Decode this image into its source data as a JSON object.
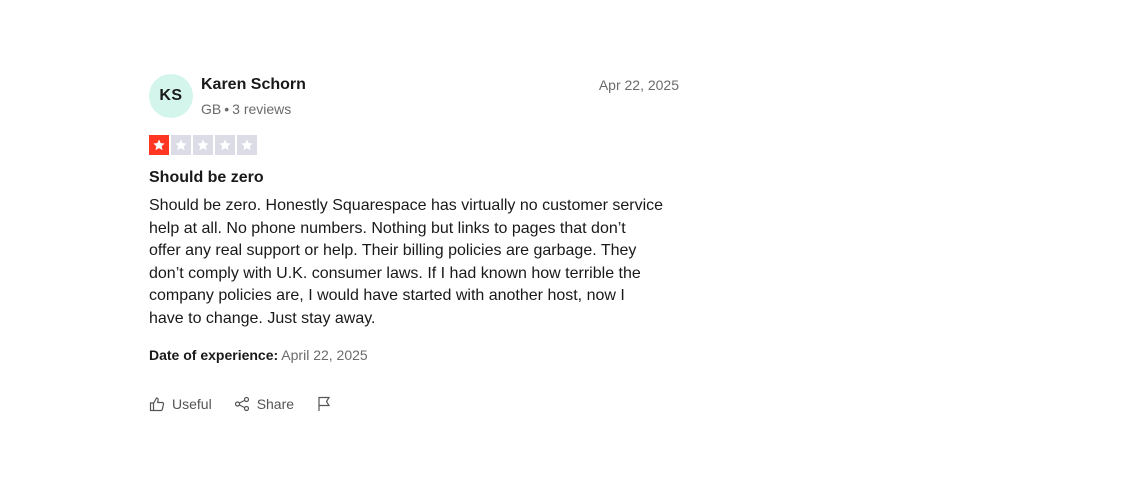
{
  "review": {
    "avatar_initials": "KS",
    "reviewer_name": "Karen Schorn",
    "country": "GB",
    "separator": "•",
    "review_count": "3 reviews",
    "date": "Apr 22, 2025",
    "rating": 1,
    "rating_max": 5,
    "title": "Should be zero",
    "body": "Should be zero. Honestly Squarespace has virtually no customer service\nhelp at all. No phone numbers. Nothing but links to pages that don’t\noffer any real support or help. Their billing policies are garbage. They\ndon’t comply with U.K. consumer laws. If I had known how terrible the\ncompany policies are, I would have started with another host, now I\nhave to change. Just stay away.",
    "experience_label": "Date of experience:",
    "experience_date": "April 22, 2025"
  },
  "actions": {
    "useful_label": "Useful",
    "share_label": "Share"
  },
  "colors": {
    "star_active": "#ff3722",
    "star_inactive": "#dcdce6",
    "avatar_bg": "#d4f5eb"
  }
}
